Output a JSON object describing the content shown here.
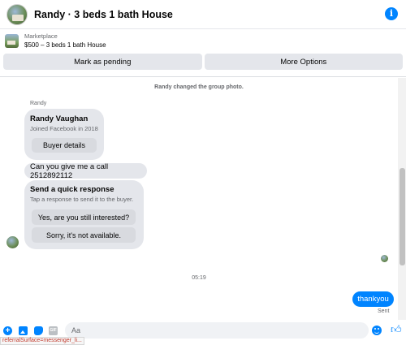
{
  "header": {
    "title": "Randy · 3 beds 1 bath House",
    "info_icon": "i"
  },
  "marketplace": {
    "label": "Marketplace",
    "listing": "$500 – 3 beds 1 bath House",
    "buttons": {
      "pending": "Mark as pending",
      "more": "More Options"
    }
  },
  "thread": {
    "system_message": "Randy changed the group photo.",
    "sender_name": "Randy",
    "buyer_card": {
      "name": "Randy Vaughan",
      "joined": "Joined Facebook in 2018",
      "button": "Buyer details"
    },
    "message": "Can you give me a call 2512892112",
    "quick_response": {
      "title": "Send a quick response",
      "subtitle": "Tap a response to send it to the buyer.",
      "option_1": "Yes, are you still interested?",
      "option_2": "Sorry, it's not available."
    },
    "timestamp": "05:19",
    "outgoing": "thankyou",
    "outgoing_status": "Sent"
  },
  "composer": {
    "placeholder": "Aa",
    "plus_icon": "+",
    "gif_icon": "GIF"
  },
  "status_bar": "referralSurface=messenger_li..."
}
